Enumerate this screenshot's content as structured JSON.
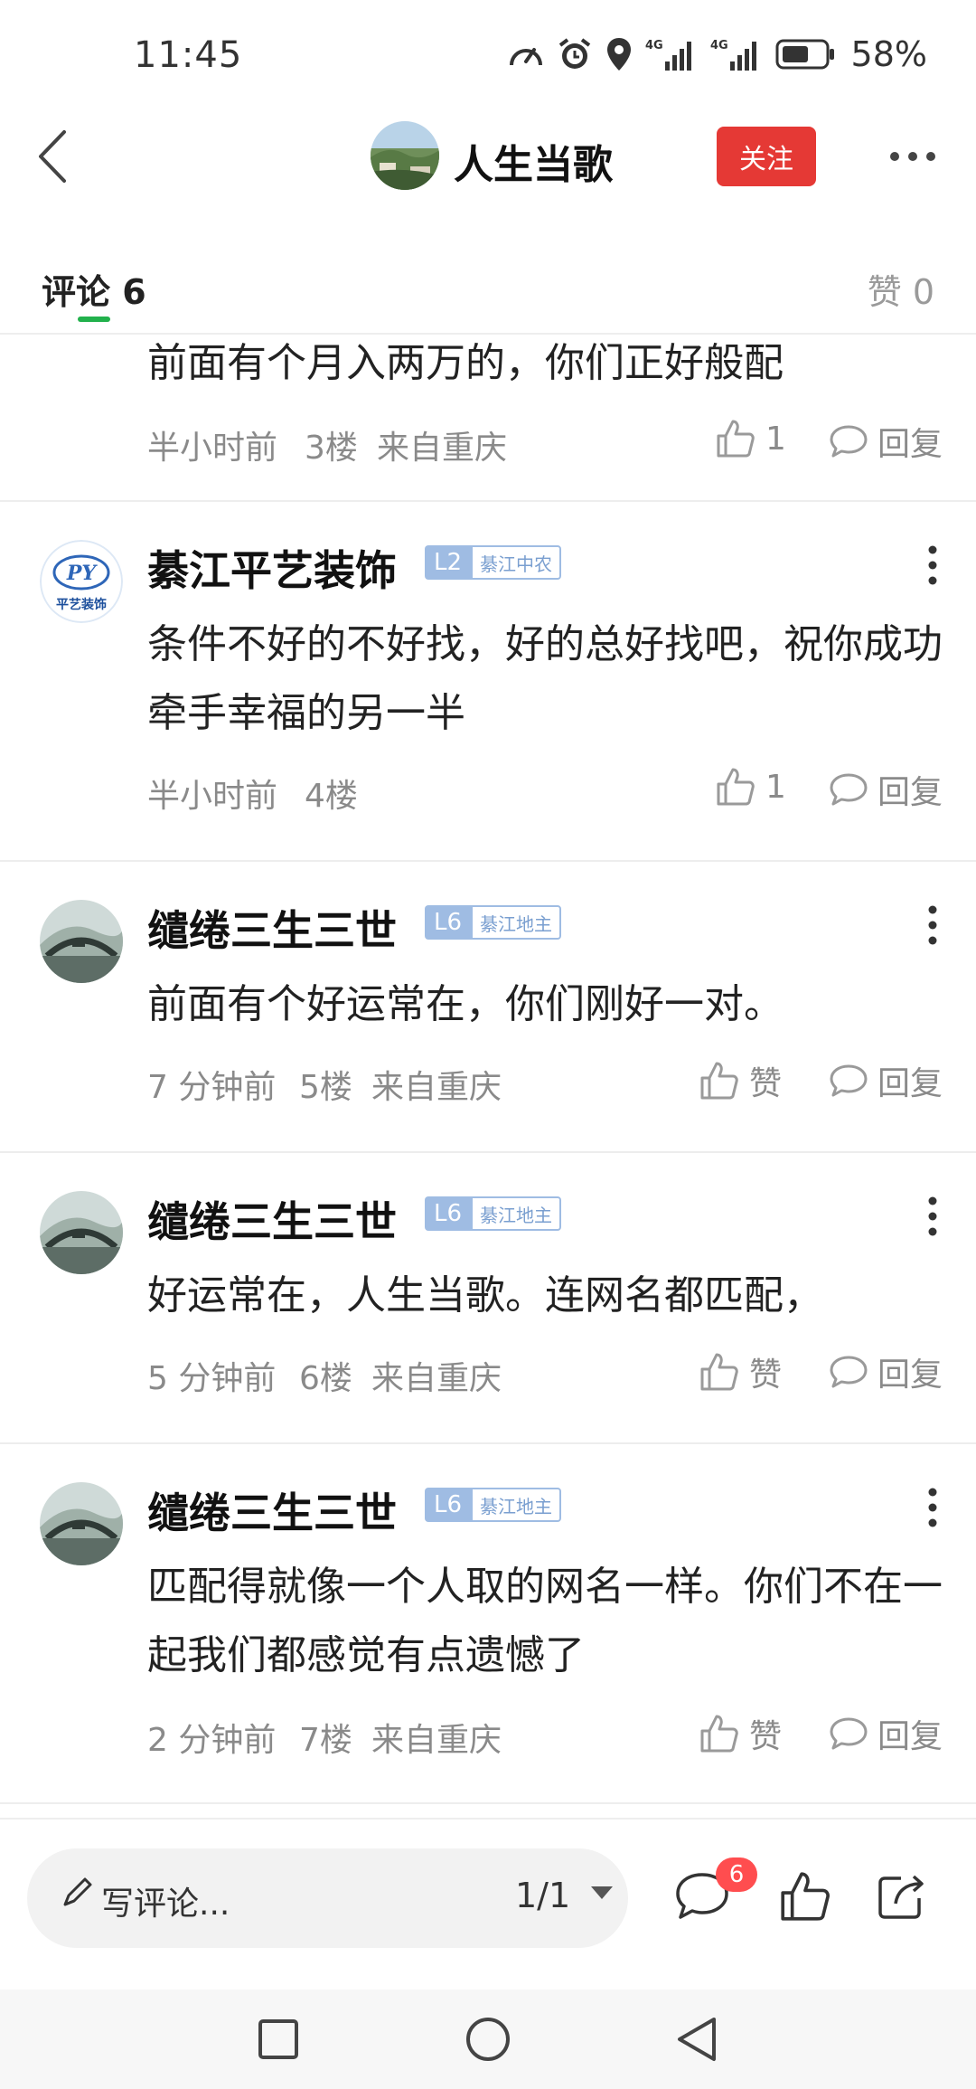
{
  "status_bar": {
    "time": "11:45",
    "battery_text": "58%",
    "icons": [
      "speed-icon",
      "alarm-icon",
      "location-icon",
      "signal-4g-icon",
      "signal-4g-icon",
      "battery-icon"
    ]
  },
  "header": {
    "author_name": "人生当歌",
    "follow_label": "关注"
  },
  "tabs": {
    "comments_label": "评论 6",
    "likes_label": "赞 0"
  },
  "comments": [
    {
      "text": "前面有个月入两万的，你们正好般配",
      "time": "半小时前",
      "floor": "3楼",
      "from": "来自重庆",
      "likes": "1",
      "reply": "回复"
    },
    {
      "name": "綦江平艺装饰",
      "level": "L2",
      "region": "綦江中农",
      "avatar_text": "PY",
      "avatar_sub": "平艺装饰",
      "text": "条件不好的不好找，好的总好找吧，祝你成功牵手幸福的另一半",
      "time": "半小时前",
      "floor": "4楼",
      "from": "",
      "likes": "1",
      "reply": "回复"
    },
    {
      "name": "缱绻三生三世",
      "level": "L6",
      "region": "綦江地主",
      "text": "前面有个好运常在，你们刚好一对。",
      "time": "7 分钟前",
      "floor": "5楼",
      "from": "来自重庆",
      "likes": "赞",
      "reply": "回复"
    },
    {
      "name": "缱绻三生三世",
      "level": "L6",
      "region": "綦江地主",
      "text": "好运常在，人生当歌。连网名都匹配，",
      "time": "5 分钟前",
      "floor": "6楼",
      "from": "来自重庆",
      "likes": "赞",
      "reply": "回复"
    },
    {
      "name": "缱绻三生三世",
      "level": "L6",
      "region": "綦江地主",
      "text": "匹配得就像一个人取的网名一样。你们不在一起我们都感觉有点遗憾了",
      "time": "2 分钟前",
      "floor": "7楼",
      "from": "来自重庆",
      "likes": "赞",
      "reply": "回复"
    }
  ],
  "bottom_bar": {
    "input_placeholder": "写评论...",
    "page_indicator": "1/1",
    "comment_count": "6"
  },
  "colors": {
    "follow_red": "#e53935",
    "tab_green": "#22b14c",
    "badge_blue": "#9fbce3",
    "count_red": "#ff4d4f"
  }
}
